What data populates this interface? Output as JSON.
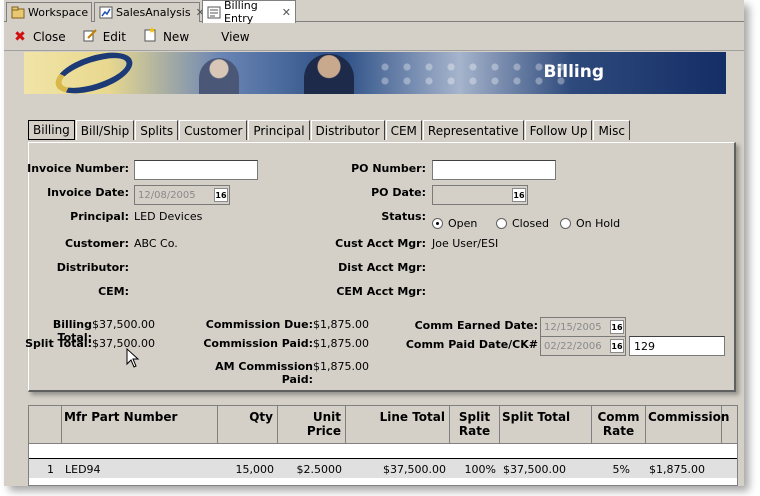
{
  "doc_tabs": [
    {
      "label": "Workspace",
      "icon": "workspace-icon"
    },
    {
      "label": "SalesAnalysis",
      "icon": "sales-analysis-icon"
    },
    {
      "label": "Billing Entry",
      "icon": "billing-entry-icon"
    }
  ],
  "toolbar": {
    "close_label": "Close",
    "edit_label": "Edit",
    "new_label": "New",
    "view_label": "View"
  },
  "banner": {
    "title": "Billing"
  },
  "form_tabs": [
    "Billing",
    "Bill/Ship",
    "Splits",
    "Customer",
    "Principal",
    "Distributor",
    "CEM",
    "Representative",
    "Follow Up",
    "Misc"
  ],
  "form": {
    "invoice_number_label": "Invoice Number:",
    "invoice_number_value": "",
    "invoice_date_label": "Invoice Date:",
    "invoice_date_value": "12/08/2005",
    "principal_label": "Principal:",
    "principal_value": "LED Devices",
    "customer_label": "Customer:",
    "customer_value": "ABC Co.",
    "distributor_label": "Distributor:",
    "distributor_value": "",
    "cem_label": "CEM:",
    "cem_value": "",
    "po_number_label": "PO Number:",
    "po_number_value": "",
    "po_date_label": "PO Date:",
    "po_date_value": "",
    "status_label": "Status:",
    "status_options": [
      "Open",
      "Closed",
      "On Hold"
    ],
    "status_selected": "Open",
    "cust_acct_mgr_label": "Cust Acct Mgr:",
    "cust_acct_mgr_value": "Joe User/ESI",
    "dist_acct_mgr_label": "Dist Acct Mgr:",
    "dist_acct_mgr_value": "",
    "cem_acct_mgr_label": "CEM Acct Mgr:",
    "cem_acct_mgr_value": "",
    "calendar_glyph": "16"
  },
  "totals": {
    "billing_total_label": "Billing Total:",
    "billing_total_value": "$37,500.00",
    "split_total_label": "Split Total:",
    "split_total_value": "$37,500.00",
    "commission_due_label": "Commission Due:",
    "commission_due_value": "$1,875.00",
    "commission_paid_label": "Commission Paid:",
    "commission_paid_value": "$1,875.00",
    "am_commission_paid_label": "AM Commission Paid:",
    "am_commission_paid_value": "$1,875.00",
    "comm_earned_date_label": "Comm Earned Date:",
    "comm_earned_date_value": "12/15/2005",
    "comm_paid_date_label": "Comm Paid Date/CK#",
    "comm_paid_date_value": "02/22/2006",
    "check_number_value": "129"
  },
  "grid": {
    "headers": {
      "part": "Mfr Part Number",
      "qty": "Qty",
      "unit_price": "Unit Price",
      "line_total": "Line Total",
      "split_rate_1": "Split",
      "split_rate_2": "Rate",
      "split_total": "Split Total",
      "comm_rate_1": "Comm",
      "comm_rate_2": "Rate",
      "commission": "Commission"
    },
    "rows": [
      {
        "num": "1",
        "part": "LED94",
        "qty": "15,000",
        "unit_price": "$2.5000",
        "line_total": "$37,500.00",
        "split_rate": "100%",
        "split_total": "$37,500.00",
        "comm_rate": "5%",
        "commission": "$1,875.00"
      }
    ]
  }
}
